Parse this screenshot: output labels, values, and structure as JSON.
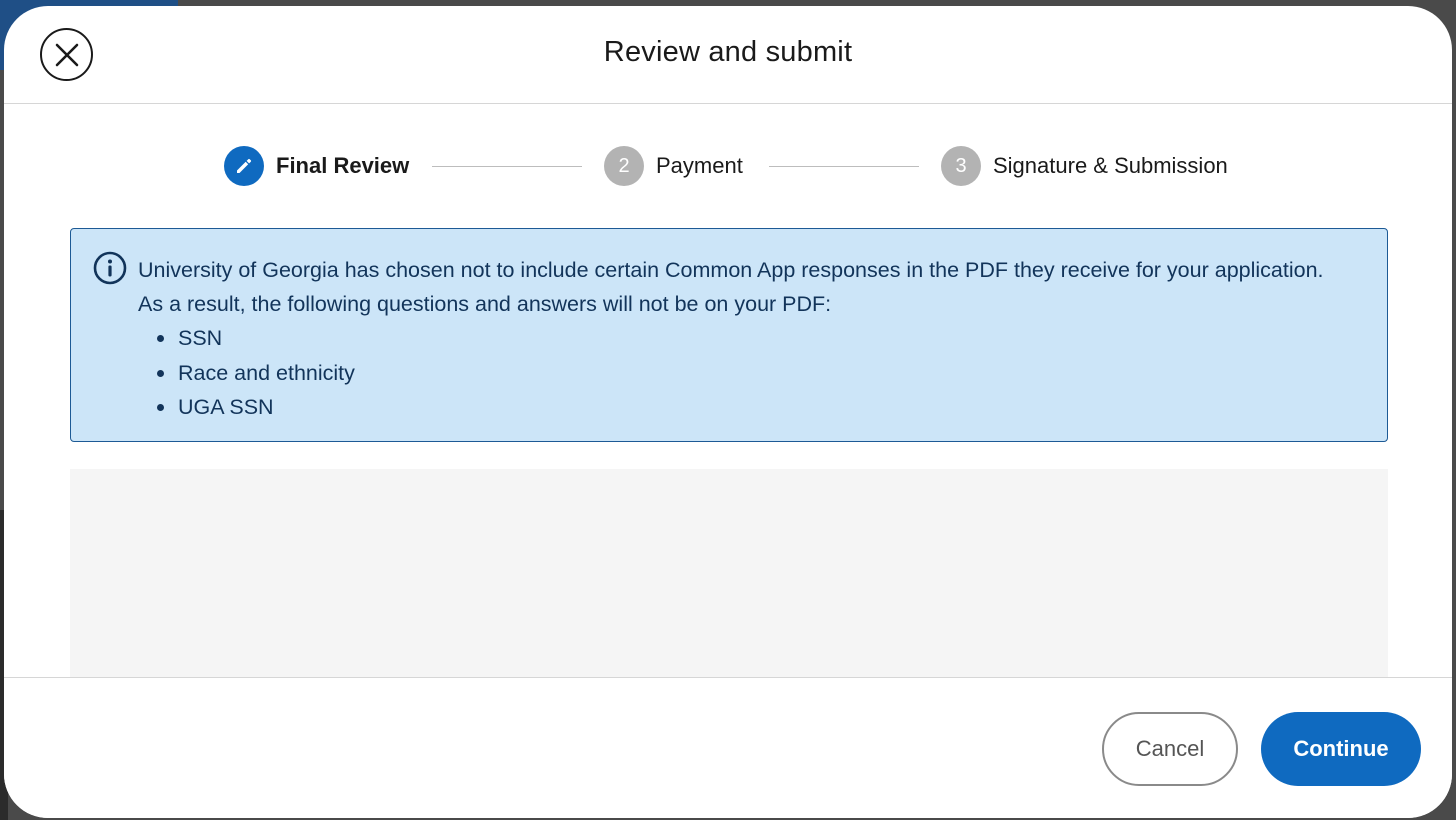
{
  "dialog": {
    "title": "Review and submit"
  },
  "stepper": {
    "steps": [
      {
        "number": "",
        "label": "Final Review",
        "state": "active",
        "icon": "pencil-icon"
      },
      {
        "number": "2",
        "label": "Payment",
        "state": "inactive"
      },
      {
        "number": "3",
        "label": "Signature & Submission",
        "state": "inactive"
      }
    ]
  },
  "notice": {
    "icon": "info-icon",
    "text": "University of Georgia has chosen not to include certain Common App responses in the PDF they receive for your application. As a result, the following questions and answers will not be on your PDF:",
    "items": [
      "SSN",
      "Race and ethnicity",
      "UGA SSN"
    ]
  },
  "footer": {
    "cancel_label": "Cancel",
    "continue_label": "Continue"
  },
  "colors": {
    "primary": "#0f6ac0",
    "notice_bg": "#cce5f8",
    "notice_border": "#1d5a95",
    "step_inactive": "#b3b3b3"
  }
}
